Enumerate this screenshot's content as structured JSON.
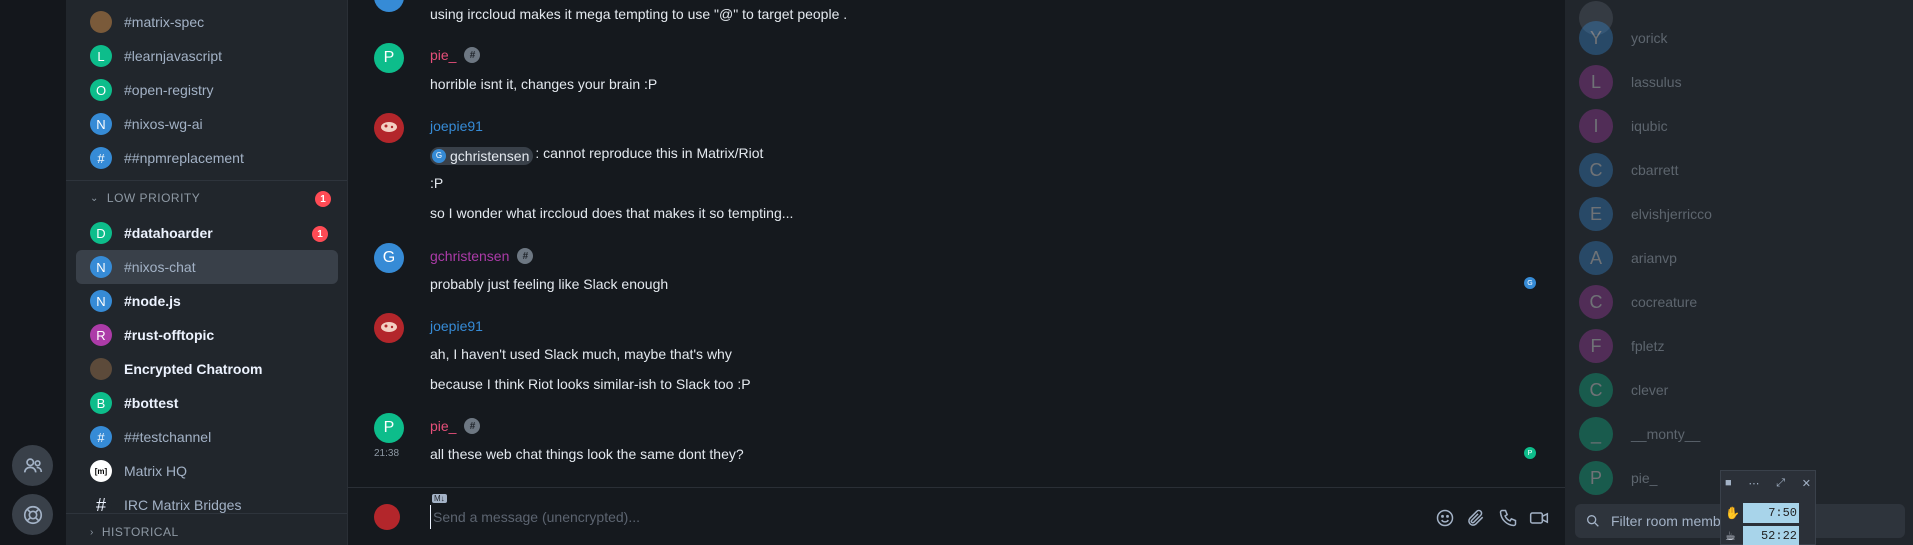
{
  "rooms": {
    "top": [
      {
        "name": "#matrix-spec",
        "letter": "",
        "color": "#7a5a3a",
        "bold": false
      },
      {
        "name": "#learnjavascript",
        "letter": "L",
        "color": "#0dbd8b",
        "bold": false
      },
      {
        "name": "#open-registry",
        "letter": "O",
        "color": "#0dbd8b",
        "bold": false
      },
      {
        "name": "#nixos-wg-ai",
        "letter": "N",
        "color": "#368bd6",
        "bold": false
      },
      {
        "name": "##npmreplacement",
        "letter": "#",
        "color": "#368bd6",
        "bold": false
      }
    ],
    "low_priority_label": "LOW PRIORITY",
    "low_priority_badge": "1",
    "low": [
      {
        "name": "#datahoarder",
        "letter": "D",
        "color": "#0dbd8b",
        "bold": true,
        "badge": "1"
      },
      {
        "name": "#nixos-chat",
        "letter": "N",
        "color": "#368bd6",
        "bold": false,
        "active": true
      },
      {
        "name": "#node.js",
        "letter": "N",
        "color": "#368bd6",
        "bold": true
      },
      {
        "name": "#rust-offtopic",
        "letter": "R",
        "color": "#ac3ba8",
        "bold": true
      },
      {
        "name": "Encrypted Chatroom",
        "letter": "",
        "color": "#5c4a3a",
        "bold": true
      },
      {
        "name": "#bottest",
        "letter": "B",
        "color": "#0dbd8b",
        "bold": true
      },
      {
        "name": "##testchannel",
        "letter": "#",
        "color": "#368bd6",
        "bold": false
      },
      {
        "name": "Matrix HQ",
        "letter": "[m]",
        "color": "#ffffff",
        "bold": false
      },
      {
        "name": "IRC Matrix Bridges",
        "letter": "#",
        "color": "#21262c",
        "bold": false
      }
    ],
    "historical_label": "HISTORICAL"
  },
  "timeline": {
    "line0": "using irccloud makes it mega tempting to use \"@\" to target people .",
    "m1_sender": "pie_",
    "m1_line1": "horrible isnt it, changes your brain :P",
    "m2_sender": "joepie91",
    "m2_pill": "gchristensen",
    "m2_line1_rest": ": cannot reproduce this in Matrix/Riot",
    "m2_line2": ":P",
    "m2_line3": "so I wonder what irccloud does that makes it so tempting...",
    "m3_sender": "gchristensen",
    "m3_line1": "probably just feeling like Slack enough",
    "m4_sender": "joepie91",
    "m4_line1": "ah, I haven't used Slack much, maybe that's why",
    "m4_line2": "because I think Riot looks similar-ish to Slack too :P",
    "m5_sender": "pie_",
    "m5_time": "21:38",
    "m5_line1": "all these web chat things look the same dont they?",
    "flair": "#",
    "avatar_p": "P",
    "avatar_g": "G"
  },
  "composer": {
    "placeholder": "Send a message (unencrypted)...",
    "md_tag": "M↓"
  },
  "members": [
    {
      "name": "yorick",
      "letter": "Y",
      "color": "#368bd6"
    },
    {
      "name": "lassulus",
      "letter": "L",
      "color": "#ac3ba8"
    },
    {
      "name": "iqubic",
      "letter": "I",
      "color": "#ac3ba8"
    },
    {
      "name": "cbarrett",
      "letter": "C",
      "color": "#368bd6"
    },
    {
      "name": "elvishjerricco",
      "letter": "E",
      "color": "#368bd6"
    },
    {
      "name": "arianvp",
      "letter": "A",
      "color": "#368bd6"
    },
    {
      "name": "cocreature",
      "letter": "C",
      "color": "#ac3ba8"
    },
    {
      "name": "fpletz",
      "letter": "F",
      "color": "#ac3ba8"
    },
    {
      "name": "clever",
      "letter": "C",
      "color": "#0dbd8b"
    },
    {
      "name": "__monty__",
      "letter": "_",
      "color": "#0dbd8b"
    },
    {
      "name": "pie_",
      "letter": "P",
      "color": "#0dbd8b"
    }
  ],
  "member_filter_placeholder": "Filter room memb",
  "widget": {
    "time1": "7:50",
    "time2": "52:22"
  }
}
